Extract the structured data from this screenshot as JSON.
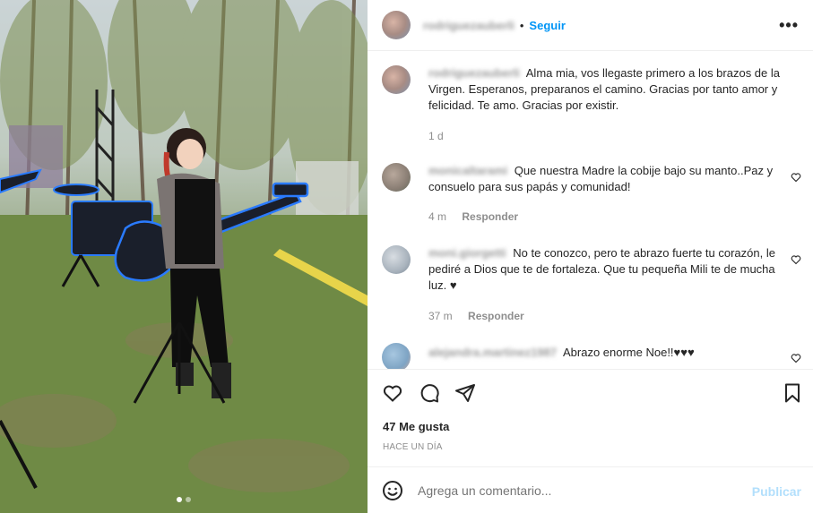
{
  "post": {
    "author": "rodriguezauberli",
    "follow_label": "Seguir",
    "separator": "•",
    "more_icon": "more-horizontal-icon",
    "caption": {
      "author": "rodriguezauberli",
      "text": "Alma mia, vos llegaste primero a los brazos de la Virgen. Esperanos, preparanos el camino. Gracias por tanto amor y felicidad. Te amo. Gracias por existir.",
      "time": "1 d"
    },
    "comments": [
      {
        "user": "monicaltarami",
        "text": "Que nuestra Madre la cobije bajo su manto..Paz y consuelo para sus papás y comunidad!",
        "time": "4 m",
        "reply_label": "Responder"
      },
      {
        "user": "moni.giorgetti",
        "text": "No te conozco, pero te abrazo fuerte tu corazón, le pediré a Dios que te de fortaleza. Que tu pequeña Mili te de mucha luz. ♥",
        "time": "37 m",
        "reply_label": "Responder"
      },
      {
        "user": "alejandra.martinez1987",
        "text": "Abrazo enorme Noe!!♥♥♥",
        "time": "",
        "reply_label": ""
      }
    ],
    "likes": "47 Me gusta",
    "timestamp": "HACE UN DÍA",
    "add_comment_placeholder": "Agrega un comentario...",
    "publish_label": "Publicar",
    "carousel": {
      "count": 2,
      "active": 0
    },
    "colors": {
      "accent": "#0095f6",
      "publish_disabled": "#b2dffc",
      "muted": "#8e8e8e"
    }
  }
}
